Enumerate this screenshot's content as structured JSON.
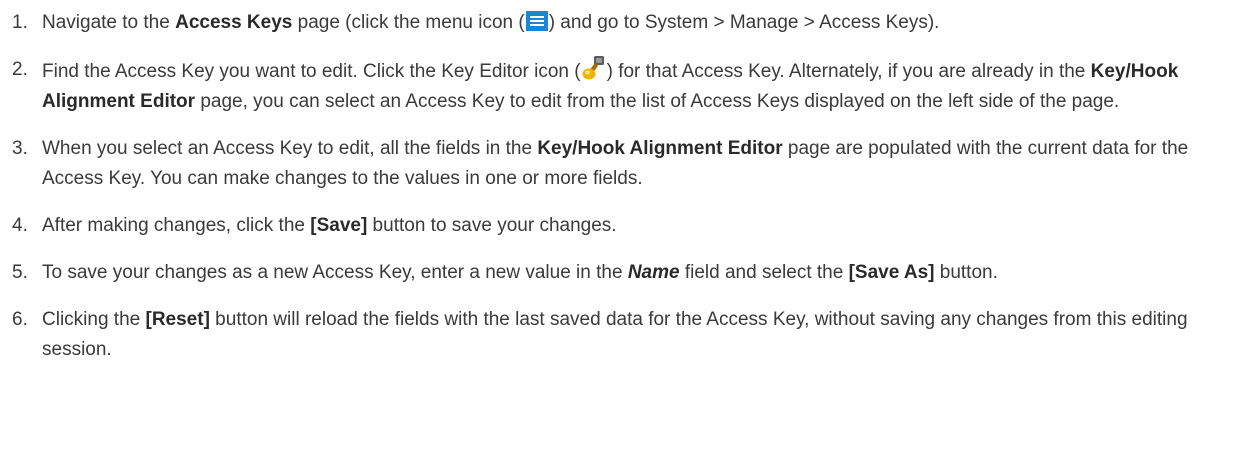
{
  "steps": [
    {
      "num": "1.",
      "t1": "Navigate to the ",
      "b1": "Access Keys",
      "t2": " page (click the menu icon (",
      "t3": ") and go to System > Manage > Access Keys)."
    },
    {
      "num": "2.",
      "t1": "Find the Access Key you want to edit. Click the Key Editor icon (",
      "t2": ") for that Access Key. Alternately, if you are already in the ",
      "b1": "Key/Hook Alignment Editor",
      "t3": " page, you can select an Access Key to edit from the list of Access Keys displayed on the left side of the page."
    },
    {
      "num": "3.",
      "t1": "When you select an Access Key to edit, all the fields in the ",
      "b1": "Key/Hook Alignment Editor",
      "t2": " page are populated with the current data for the Access Key. You can make changes to the values in one or more fields."
    },
    {
      "num": "4.",
      "t1": "After making changes, click the ",
      "b1": "[Save]",
      "t2": " button to save your changes."
    },
    {
      "num": "5.",
      "t1": "To save your changes as a new Access Key, enter a new value in the ",
      "e1": "Name",
      "t2": " field and select the ",
      "b1": "[Save As]",
      "t3": " button."
    },
    {
      "num": "6.",
      "t1": "Clicking the ",
      "b1": "[Reset]",
      "t2": " button will reload the fields with the last saved data for the Access Key, without saving any changes from this editing session."
    }
  ],
  "icons": {
    "menu_icon": "menu-icon",
    "key_editor_icon": "key-editor-icon",
    "menu_icon_color": "#1a86d8",
    "key_icon_color": "#f0b400"
  }
}
